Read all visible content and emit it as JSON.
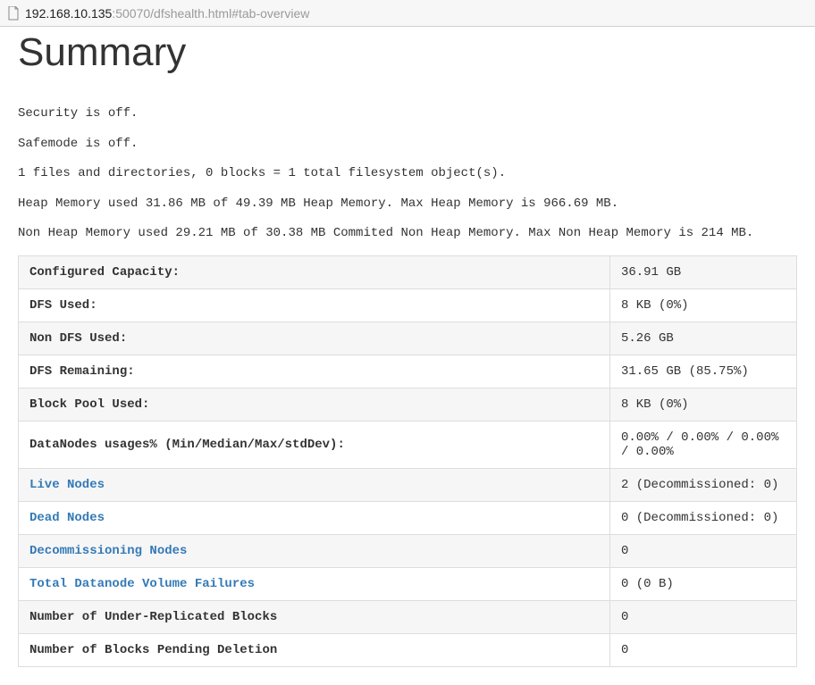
{
  "address_bar": {
    "url_host": "192.168.10.135",
    "url_rest": ":50070/dfshealth.html#tab-overview"
  },
  "title": "Summary",
  "status_lines": {
    "security": "Security is off.",
    "safemode": "Safemode is off.",
    "files": "1 files and directories, 0 blocks = 1 total filesystem object(s).",
    "heap": "Heap Memory used 31.86 MB of 49.39 MB Heap Memory. Max Heap Memory is 966.69 MB.",
    "nonheap": "Non Heap Memory used 29.21 MB of 30.38 MB Commited Non Heap Memory. Max Non Heap Memory is 214 MB."
  },
  "rows": {
    "configured_capacity": {
      "label": "Configured Capacity:",
      "value": "36.91 GB"
    },
    "dfs_used": {
      "label": "DFS Used:",
      "value": "8 KB (0%)"
    },
    "non_dfs_used": {
      "label": "Non DFS Used:",
      "value": "5.26 GB"
    },
    "dfs_remaining": {
      "label": "DFS Remaining:",
      "value": "31.65 GB (85.75%)"
    },
    "block_pool_used": {
      "label": "Block Pool Used:",
      "value": "8 KB (0%)"
    },
    "datanodes_usage": {
      "label": "DataNodes usages% (Min/Median/Max/stdDev):",
      "value": "0.00% / 0.00% / 0.00% / 0.00%"
    },
    "live_nodes": {
      "label": "Live Nodes",
      "value": "2 (Decommissioned: 0)"
    },
    "dead_nodes": {
      "label": "Dead Nodes",
      "value": "0 (Decommissioned: 0)"
    },
    "decom_nodes": {
      "label": "Decommissioning Nodes",
      "value": "0"
    },
    "volume_failures": {
      "label": "Total Datanode Volume Failures",
      "value": "0 (0 B)"
    },
    "under_replicated": {
      "label": "Number of Under-Replicated Blocks",
      "value": "0"
    },
    "pending_deletion": {
      "label": "Number of Blocks Pending Deletion",
      "value": "0"
    }
  }
}
